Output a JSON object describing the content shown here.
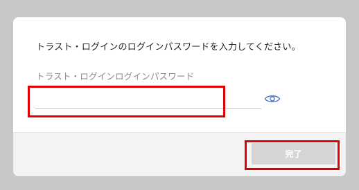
{
  "dialog": {
    "message": "トラスト・ログインのログインパスワードを入力してください。",
    "password_label": "トラスト・ログインログインパスワード",
    "password_value": "",
    "show_password_icon": "eye-icon",
    "done_label": "完了"
  },
  "colors": {
    "backdrop": "#c8c8c8",
    "dialog_bg": "#ffffff",
    "footer_bg": "#f3f3f3",
    "button_disabled": "#d6d6d6",
    "eye_icon": "#4a78c8",
    "annotation": "#e00000"
  }
}
